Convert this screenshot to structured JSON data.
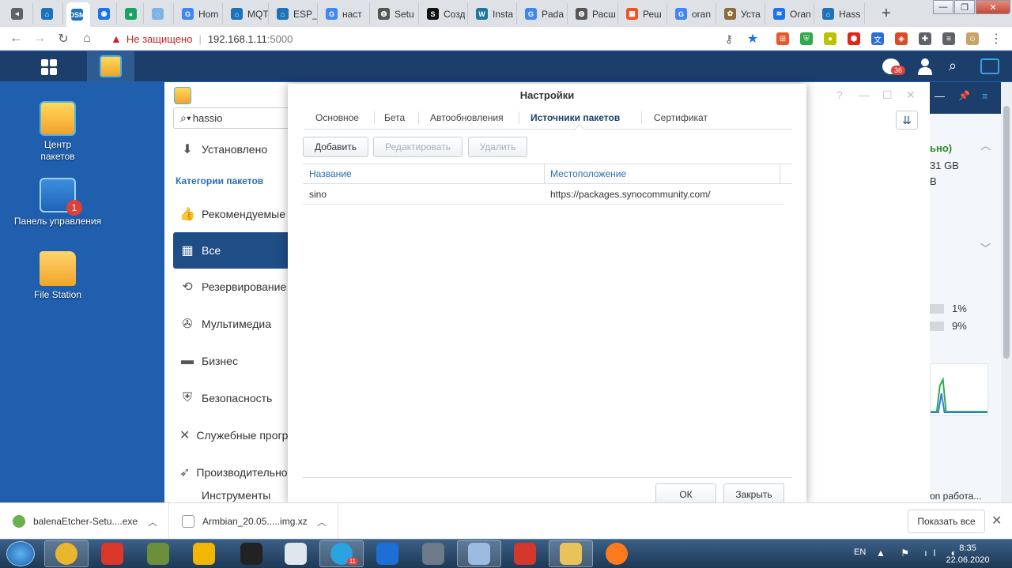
{
  "browser": {
    "tabs": [
      {
        "label": "",
        "color": "#5f6368",
        "glyph": "◂"
      },
      {
        "label": "",
        "color": "#1d72b8",
        "glyph": "⌂"
      },
      {
        "label": "",
        "color": "#1d72b8",
        "glyph": "DSM"
      },
      {
        "label": "",
        "color": "#1a73e8",
        "glyph": "◉"
      },
      {
        "label": "",
        "color": "#1aa260",
        "glyph": "●"
      },
      {
        "label": "",
        "color": "#7fb2e5",
        "glyph": "◌"
      },
      {
        "label": "Hom",
        "color": "#4285f4",
        "glyph": "G"
      },
      {
        "label": "MQT",
        "color": "#1d72b8",
        "glyph": "⌂"
      },
      {
        "label": "ESP_",
        "color": "#1d72b8",
        "glyph": "⌂"
      },
      {
        "label": "наст",
        "color": "#4285f4",
        "glyph": "G"
      },
      {
        "label": "Setu",
        "color": "#555555",
        "glyph": "◍"
      },
      {
        "label": "Созд",
        "color": "#111111",
        "glyph": "S"
      },
      {
        "label": "Insta",
        "color": "#21759b",
        "glyph": "W"
      },
      {
        "label": "Pada",
        "color": "#4285f4",
        "glyph": "G"
      },
      {
        "label": "Расш",
        "color": "#555555",
        "glyph": "◍"
      },
      {
        "label": "Реш",
        "color": "#f25022",
        "glyph": "▦"
      },
      {
        "label": "oran",
        "color": "#4285f4",
        "glyph": "G"
      },
      {
        "label": "Уста",
        "color": "#8a6d3b",
        "glyph": "✿"
      },
      {
        "label": "Oran",
        "color": "#1a73e8",
        "glyph": "≋"
      },
      {
        "label": "Hass",
        "color": "#1d72b8",
        "glyph": "⌂"
      }
    ],
    "new_tab": "+",
    "window_controls": {
      "minimize": "—",
      "maximize": "❐",
      "close": "✕"
    },
    "nav": {
      "back": "←",
      "forward": "→",
      "reload": "↻",
      "home": "⌂"
    },
    "address": {
      "warning_icon": "▲",
      "security_label": "Не защищено",
      "separator": "|",
      "url": "192.168.1.11",
      "port": ":5000"
    },
    "toolbar_icons": {
      "key": "⚷",
      "star": "★",
      "menu": "⋮"
    },
    "extensions": [
      {
        "name": "shop-icon",
        "color": "#e8572b",
        "glyph": "⊞"
      },
      {
        "name": "shield-icon",
        "color": "#2fa84f",
        "glyph": "⛨"
      },
      {
        "name": "coin-icon",
        "color": "#b8c400",
        "glyph": "●"
      },
      {
        "name": "adblock-icon",
        "color": "#e0251b",
        "glyph": "⬢"
      },
      {
        "name": "translate-icon",
        "color": "#2b6fd6",
        "glyph": "文"
      },
      {
        "name": "badge-icon",
        "color": "#d84e2a",
        "glyph": "◈"
      },
      {
        "name": "puzzle-icon",
        "color": "#5f6368",
        "glyph": "✚"
      },
      {
        "name": "queue-icon",
        "color": "#5f6368",
        "glyph": "≡"
      },
      {
        "name": "profile-icon",
        "color": "#c9a36b",
        "glyph": "☺"
      }
    ]
  },
  "dsm": {
    "notification_count": "36",
    "search_glyph": "⌕"
  },
  "desktop": {
    "icons": [
      {
        "label": "Центр пакетов"
      },
      {
        "label": "Панель управления",
        "badge": "1"
      },
      {
        "label": "File Station"
      }
    ]
  },
  "package_center": {
    "search_value": "hassio",
    "search_glyph": "⌕▾",
    "installed_label": "Установлено",
    "categories_heading": "Категории пакетов",
    "categories": [
      {
        "label": "Рекомендуемые",
        "glyph": "👍"
      },
      {
        "label": "Все",
        "glyph": "▦",
        "selected": true
      },
      {
        "label": "Резервирование",
        "glyph": "⟲"
      },
      {
        "label": "Мультимедиа",
        "glyph": "✇"
      },
      {
        "label": "Бизнес",
        "glyph": "▬"
      },
      {
        "label": "Безопасность",
        "glyph": "⛨"
      },
      {
        "label": "Служебные программы",
        "glyph": "✕"
      },
      {
        "label": "Производительность",
        "glyph": "➶"
      },
      {
        "label": "Инструменты",
        "glyph": ""
      }
    ],
    "header_buttons": {
      "help": "?",
      "minimize": "—",
      "maximize": "☐",
      "close": "✕"
    },
    "sort_glyph": "⇊"
  },
  "settings_dialog": {
    "title": "Настройки",
    "tabs": [
      {
        "label": "Основное"
      },
      {
        "label": "Бета"
      },
      {
        "label": "Автообновления"
      },
      {
        "label": "Источники пакетов",
        "active": true
      },
      {
        "label": "Сертификат"
      }
    ],
    "toolbar": {
      "add": "Добавить",
      "edit": "Редактировать",
      "delete": "Удалить"
    },
    "columns": [
      "Название",
      "Местоположение"
    ],
    "rows": [
      {
        "name": "sino",
        "location": "https://packages.synocommunity.com/"
      }
    ],
    "ok_label": "ОК",
    "close_label": "Закрыть"
  },
  "widget": {
    "status_fragment": "ьно)",
    "disk_fragment": "31 GB",
    "disk_fragment2": "B",
    "cpu_percent": "1%",
    "ram_percent": "9%",
    "footer_fragment": "on работа...",
    "header_icons": {
      "minimize": "—",
      "pin": "📌",
      "menu": "≡"
    },
    "chevron_up": "︿",
    "chevron_down": "﹀"
  },
  "downloads": {
    "items": [
      {
        "file": "balenaEtcher-Setu....exe",
        "color": "#6ab04c"
      },
      {
        "file": "Armbian_20.05.....img.xz",
        "color": "#ffffff"
      }
    ],
    "chevron": "︿",
    "show_all": "Показать все",
    "close": "✕"
  },
  "taskbar": {
    "apps": [
      {
        "name": "chrome-icon",
        "color": "#e8b72e",
        "open": true
      },
      {
        "name": "ccleaner-icon",
        "color": "#d9382b",
        "open": false
      },
      {
        "name": "minecraft-icon",
        "color": "#6b8f3a",
        "open": false
      },
      {
        "name": "rockstar-icon",
        "color": "#f2b705",
        "open": false
      },
      {
        "name": "epic-games-icon",
        "color": "#222222",
        "open": false
      },
      {
        "name": "installer-icon",
        "color": "#dfe6ee",
        "open": false
      },
      {
        "name": "telegram-icon",
        "color": "#2aa3e0",
        "open": true
      },
      {
        "name": "network-icon",
        "color": "#1d6fd6",
        "open": false
      },
      {
        "name": "lock-app-icon",
        "color": "#6c7a89",
        "open": false
      },
      {
        "name": "remote-icon",
        "color": "#9bbce0",
        "open": true
      },
      {
        "name": "dice-icon",
        "color": "#d4382c",
        "open": false
      },
      {
        "name": "explorer-icon",
        "color": "#e8c35b",
        "open": true
      },
      {
        "name": "firefox-icon",
        "color": "#ff7a1f",
        "open": false
      }
    ],
    "telegram_badge": "11",
    "language": "EN",
    "tray_glyphs": "▲ ⚑ ıl ◐",
    "time": "8:35",
    "date": "22.06.2020"
  }
}
